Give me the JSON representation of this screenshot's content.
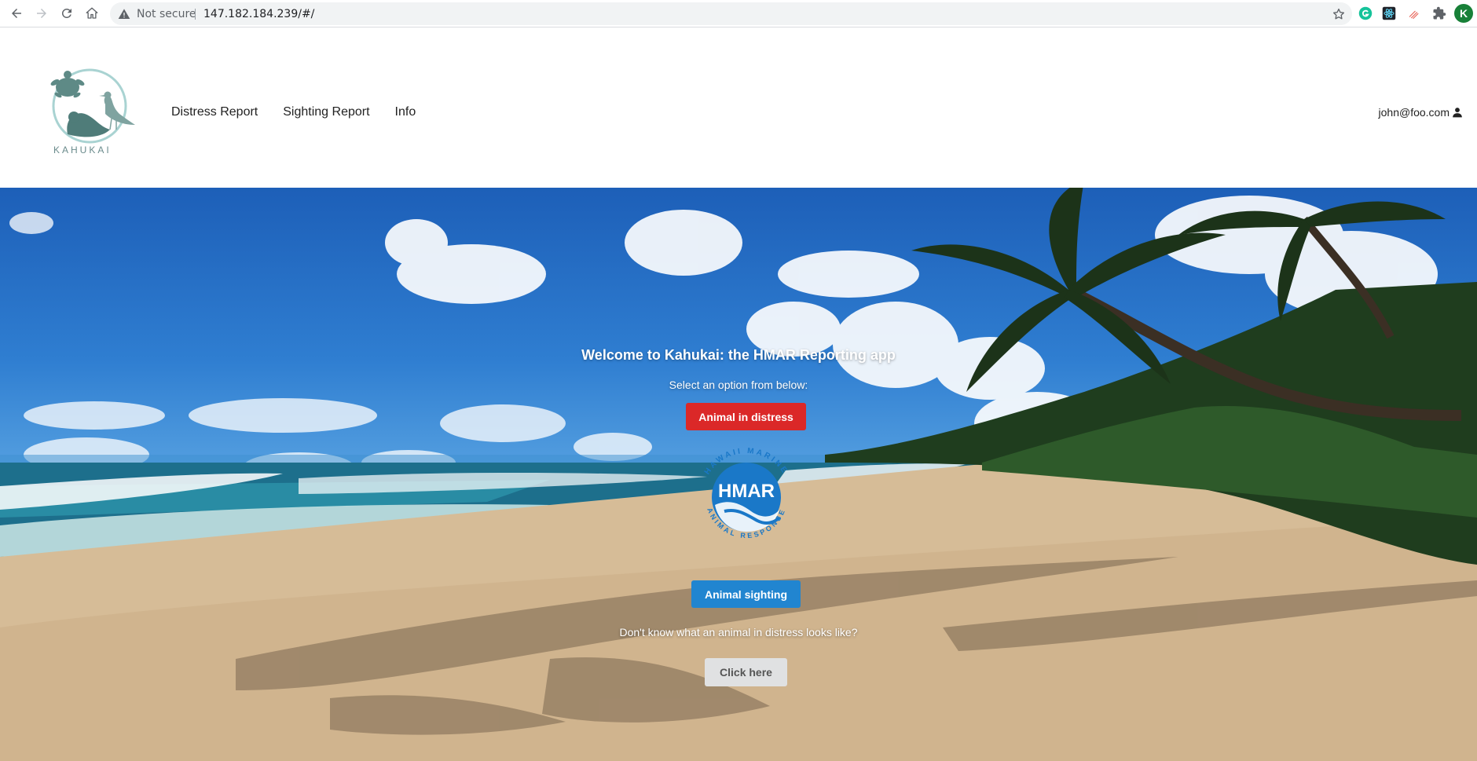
{
  "browser": {
    "security_label": "Not secure",
    "url": "147.182.184.239/#/",
    "profile_initial": "K",
    "icons": [
      "back-icon",
      "forward-icon",
      "reload-icon",
      "home-icon",
      "warning-icon",
      "star-icon",
      "grammarly-icon",
      "react-devtools-icon",
      "extension-icon",
      "puzzle-icon"
    ]
  },
  "header": {
    "logo_text": "KAHUKAI",
    "nav": [
      {
        "label": "Distress Report"
      },
      {
        "label": "Sighting Report"
      },
      {
        "label": "Info"
      }
    ],
    "user_email": "john@foo.com"
  },
  "hero": {
    "title": "Welcome to Kahukai: the HMAR Reporting app",
    "subtitle": "Select an option from below:",
    "distress_button": "Animal in distress",
    "hmar_logo": {
      "abbr": "HMAR",
      "ring_top": "HAWAII MARINE",
      "ring_bottom": "ANIMAL RESPONSE"
    },
    "sighting_button": "Animal sighting",
    "question": "Don't know what an animal in distress looks like?",
    "click_button": "Click here"
  },
  "colors": {
    "distress": "#db2828",
    "sighting": "#2185d0",
    "neutral_button": "#e0e1e2",
    "hmar_blue": "#1a78c8"
  }
}
